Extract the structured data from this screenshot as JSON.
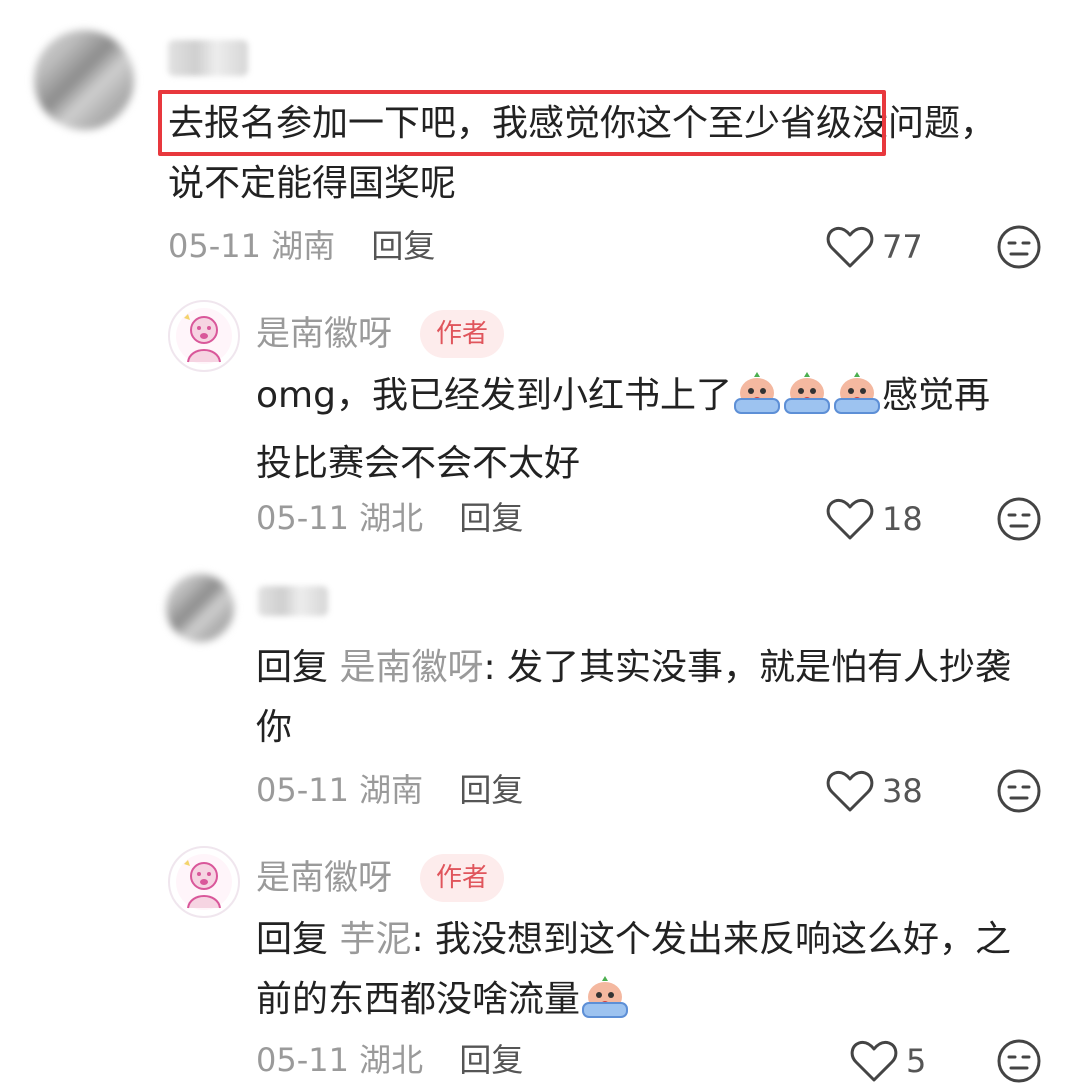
{
  "comments": [
    {
      "username": "",
      "text_line1": "去报名参加一下吧，我感觉你这个至少省级没问题，",
      "text_line2": "说不定能得国奖呢",
      "date": "05-11",
      "location": "湖南",
      "reply_label": "回复",
      "likes": "77"
    },
    {
      "username": "是南徽呀",
      "badge": "作者",
      "text_line1": "omg，我已经发到小红书上了",
      "text_line1_suffix": "感觉再",
      "text_line2": "投比赛会不会不太好",
      "date": "05-11",
      "location": "湖北",
      "reply_label": "回复",
      "likes": "18"
    },
    {
      "username": "",
      "reply_prefix": "回复",
      "reply_to": "是南徽呀",
      "text_line1": ": 发了其实没事，就是怕有人抄袭",
      "text_line2": "你",
      "date": "05-11",
      "location": "湖南",
      "reply_label": "回复",
      "likes": "38"
    },
    {
      "username": "是南徽呀",
      "badge": "作者",
      "reply_prefix": "回复",
      "reply_to": "芋泥",
      "text_line1": ": 我没想到这个发出来反响这么好，之",
      "text_line2": "前的东西都没啥流量",
      "date": "05-11",
      "location": "湖北",
      "reply_label": "回复",
      "likes": "5"
    }
  ],
  "icons": {
    "like": "heart-outline-icon",
    "dislike": "neutral-face-icon",
    "emoji": "crying-sticker-emoji"
  },
  "colors": {
    "highlight_border": "#e8383d",
    "badge_bg": "#fdecec",
    "badge_text": "#e0555c",
    "secondary_text": "#9a9a9a"
  }
}
